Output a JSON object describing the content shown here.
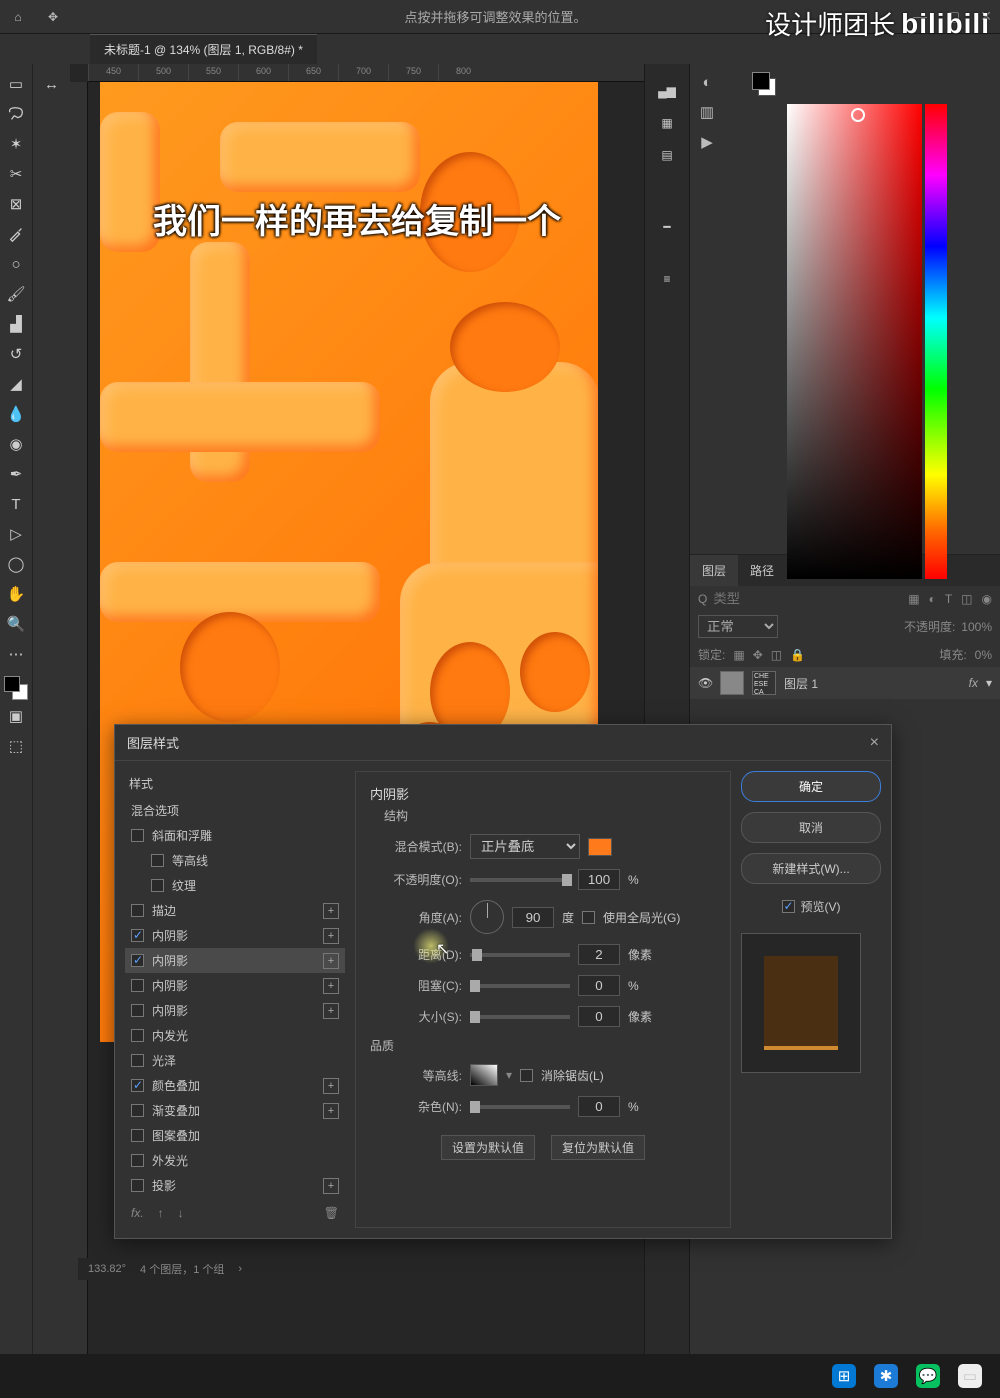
{
  "top_hint": "点按并拖移可调整效果的位置。",
  "tab_title": "未标题-1 @ 134% (图层 1, RGB/8#) *",
  "ruler_h": [
    "450",
    "500",
    "550",
    "600",
    "650",
    "700",
    "750",
    "800"
  ],
  "subtitle": "我们一样的再去给复制一个",
  "watermark_cn": "设计师团长",
  "watermark_bili": "bilibili",
  "panels": {
    "layers_tab": "图层",
    "paths_tab": "路径",
    "filter_placeholder": "类型",
    "filter_prefix": "Q",
    "blend_mode": "正常",
    "opacity_label": "不透明度:",
    "opacity_val": "100%",
    "lock_label": "锁定:",
    "fill_label": "填充:",
    "fill_val": "0%",
    "layer_name": "图层 1",
    "fx": "fx"
  },
  "dialog": {
    "title": "图层样式",
    "styles_header": "样式",
    "blend_options": "混合选项",
    "rows": {
      "bevel": "斜面和浮雕",
      "contour": "等高线",
      "texture": "纹理",
      "stroke": "描边",
      "inner_shadow": "内阴影",
      "inner_glow": "内发光",
      "satin": "光泽",
      "color_overlay": "颜色叠加",
      "gradient_overlay": "渐变叠加",
      "pattern_overlay": "图案叠加",
      "outer_glow": "外发光",
      "drop_shadow": "投影"
    },
    "section": "内阴影",
    "structure": "结构",
    "blend_label": "混合模式(B):",
    "blend_val": "正片叠底",
    "opacity_label": "不透明度(O):",
    "opacity_val": "100",
    "pct": "%",
    "angle_label": "角度(A):",
    "angle_val": "90",
    "deg": "度",
    "global": "使用全局光(G)",
    "distance_label": "距离(D):",
    "distance_val": "2",
    "px": "像素",
    "spread_label": "阻塞(C):",
    "spread_val": "0",
    "size_label": "大小(S):",
    "size_val": "0",
    "quality": "品质",
    "contour_label": "等高线:",
    "anti_alias": "消除锯齿(L)",
    "noise_label": "杂色(N):",
    "noise_val": "0",
    "set_default": "设置为默认值",
    "reset_default": "复位为默认值",
    "ok": "确定",
    "cancel": "取消",
    "new_style": "新建样式(W)...",
    "preview": "预览(V)"
  },
  "status": {
    "zoom": "133.82°",
    "info": "4 个图层，1 个组"
  }
}
